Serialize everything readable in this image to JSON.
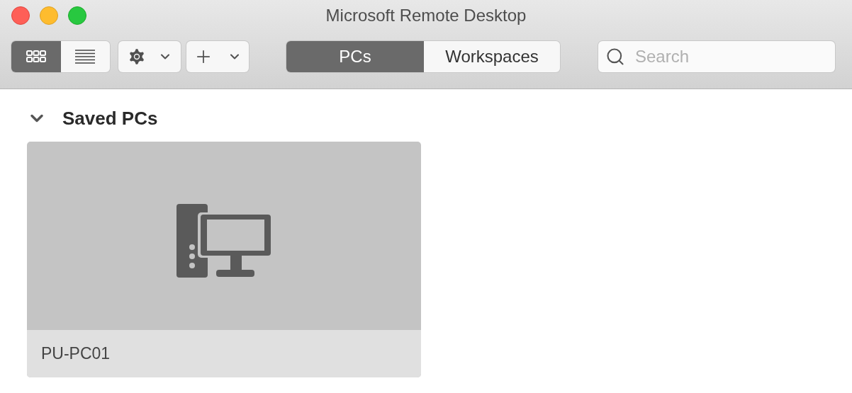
{
  "window": {
    "title": "Microsoft Remote Desktop"
  },
  "view_toggle": [
    {
      "kind": "grid",
      "selected": true
    },
    {
      "kind": "list",
      "selected": false
    }
  ],
  "tabs": [
    {
      "label": "PCs",
      "selected": true
    },
    {
      "label": "Workspaces",
      "selected": false
    }
  ],
  "search": {
    "placeholder": "Search"
  },
  "section": {
    "title": "Saved PCs",
    "expanded": true,
    "pcs": [
      {
        "name": "PU-PC01"
      }
    ]
  }
}
